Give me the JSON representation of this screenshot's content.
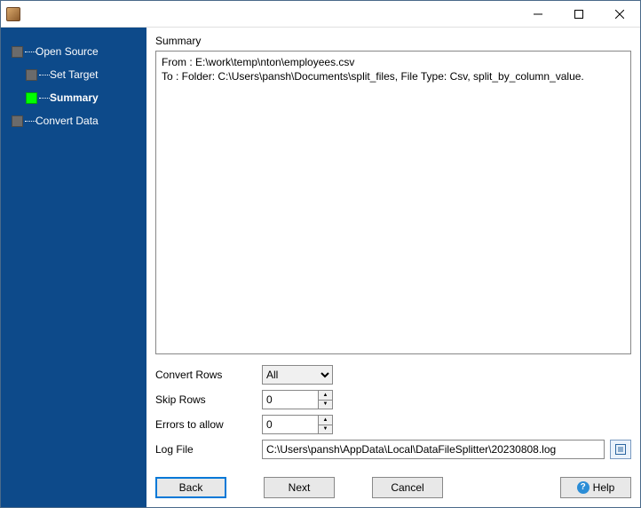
{
  "titlebar": {
    "title": ""
  },
  "sidebar": {
    "items": [
      {
        "label": "Open Source",
        "active": false,
        "child": false
      },
      {
        "label": "Set Target",
        "active": false,
        "child": true
      },
      {
        "label": "Summary",
        "active": true,
        "child": true
      },
      {
        "label": "Convert Data",
        "active": false,
        "child": false
      }
    ]
  },
  "main": {
    "section_title": "Summary",
    "summary_lines": {
      "from": "From : E:\\work\\temp\\nton\\employees.csv",
      "to": "To : Folder: C:\\Users\\pansh\\Documents\\split_files, File Type: Csv, split_by_column_value."
    },
    "options": {
      "convert_rows": {
        "label": "Convert Rows",
        "value": "All"
      },
      "skip_rows": {
        "label": "Skip Rows",
        "value": "0"
      },
      "errors_allow": {
        "label": "Errors to allow",
        "value": "0"
      },
      "log_file": {
        "label": "Log File",
        "value": "C:\\Users\\pansh\\AppData\\Local\\DataFileSplitter\\20230808.log"
      }
    },
    "buttons": {
      "back": "Back",
      "next": "Next",
      "cancel": "Cancel",
      "help": "Help"
    }
  }
}
